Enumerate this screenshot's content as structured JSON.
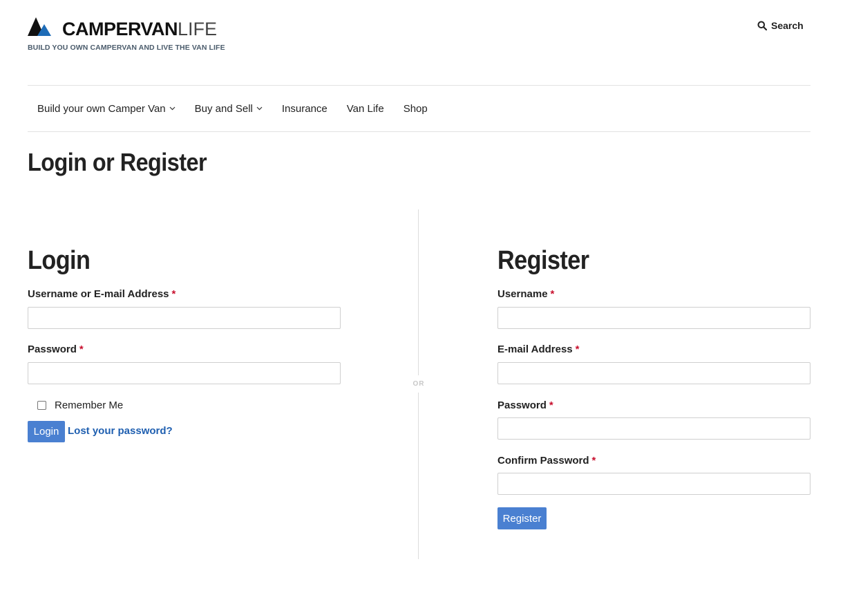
{
  "header": {
    "logo": {
      "bold": "CAMPERVAN",
      "light": "LIFE"
    },
    "tagline": "BUILD YOU OWN CAMPERVAN AND LIVE THE VAN LIFE",
    "search_label": "Search"
  },
  "nav": {
    "items": [
      {
        "label": "Build your own Camper Van",
        "dropdown": true
      },
      {
        "label": "Buy and Sell",
        "dropdown": true
      },
      {
        "label": "Insurance",
        "dropdown": false
      },
      {
        "label": "Van Life",
        "dropdown": false
      },
      {
        "label": "Shop",
        "dropdown": false
      }
    ]
  },
  "page": {
    "title": "Login or Register",
    "divider_text": "OR"
  },
  "login": {
    "title": "Login",
    "username_label": "Username or E-mail Address",
    "username_value": "",
    "password_label": "Password",
    "password_value": "",
    "remember_label": "Remember Me",
    "remember_checked": false,
    "submit_label": "Login",
    "lost_password_label": "Lost your password?"
  },
  "register": {
    "title": "Register",
    "username_label": "Username",
    "username_value": "",
    "email_label": "E-mail Address",
    "email_value": "",
    "password_label": "Password",
    "password_value": "",
    "confirm_label": "Confirm Password",
    "confirm_value": "",
    "submit_label": "Register"
  },
  "required_marker": "*",
  "colors": {
    "button": "#4a80d1",
    "link": "#1f5fb0",
    "required": "#c8102e",
    "logo_dark": "#111111",
    "logo_blue": "#1e6cb7"
  },
  "icons": {
    "search": "search-icon",
    "dropdown": "chevron-down-icon",
    "logo": "mountain-logo-icon"
  }
}
